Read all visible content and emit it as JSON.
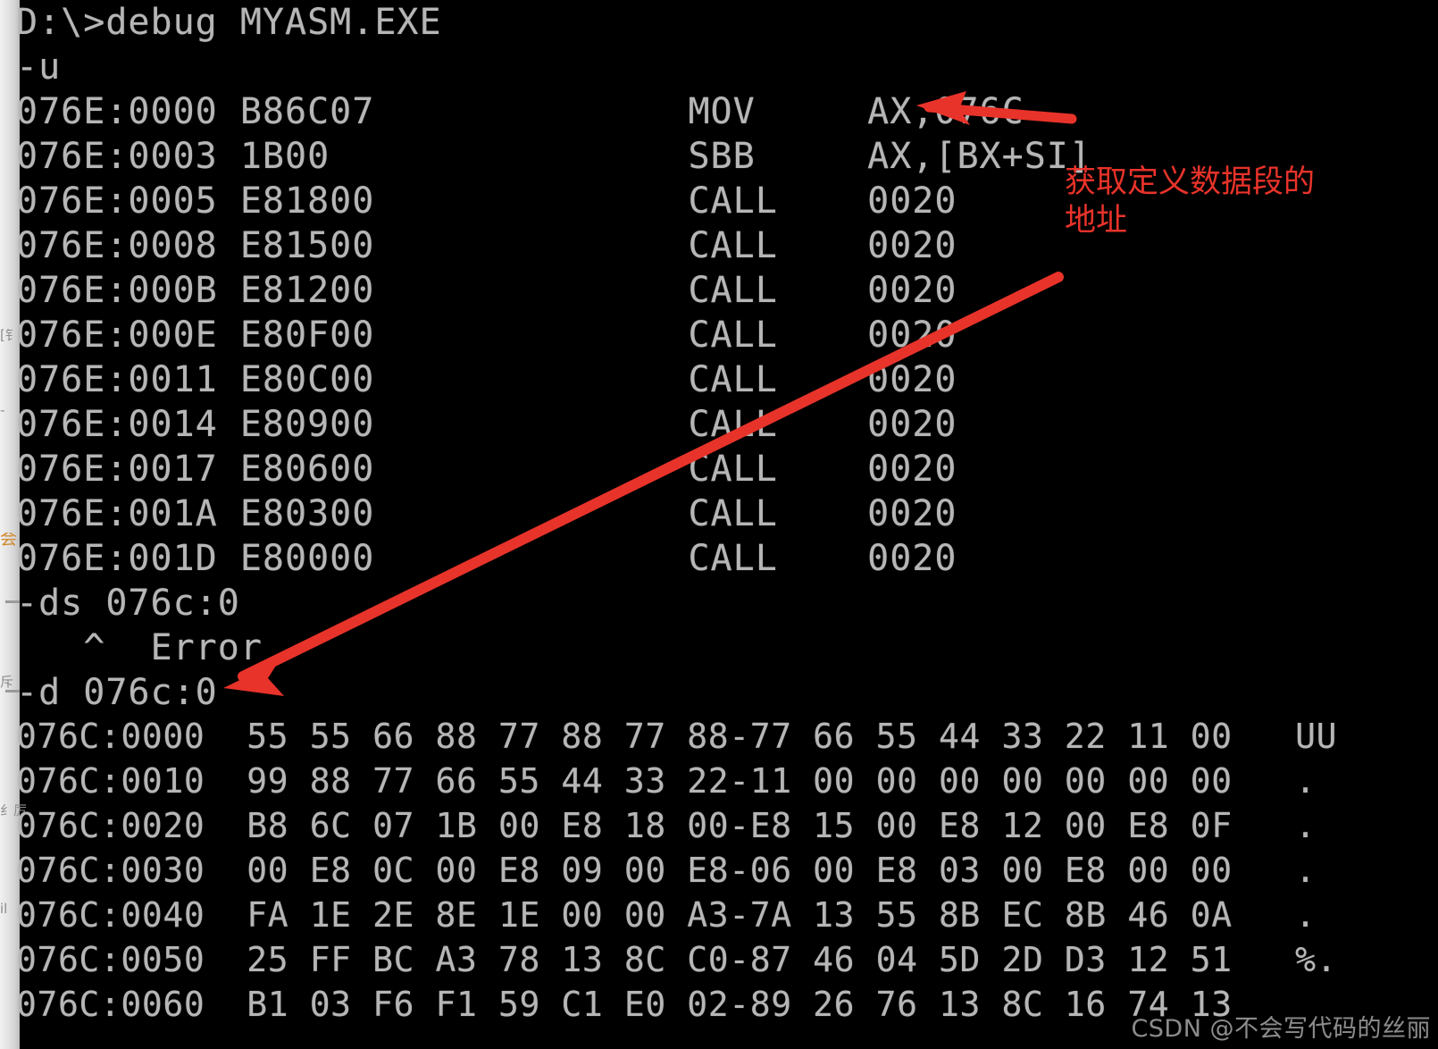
{
  "terminal": {
    "prompt_line": "D:\\>debug MYASM.EXE",
    "unassemble_command": "-u",
    "disassembly": [
      "076E:0000 B86C07              MOV     AX,076C",
      "076E:0003 1B00                SBB     AX,[BX+SI]",
      "076E:0005 E81800              CALL    0020",
      "076E:0008 E81500              CALL    0020",
      "076E:000B E81200              CALL    0020",
      "076E:000E E80F00              CALL    0020",
      "076E:0011 E80C00              CALL    0020",
      "076E:0014 E80900              CALL    0020",
      "076E:0017 E80600              CALL    0020",
      "076E:001A E80300              CALL    0020",
      "076E:001D E80000              CALL    0020"
    ],
    "bad_command": "-ds 076c:0",
    "error_caret": "   ^  Error",
    "dump_command": "-d 076c:0",
    "dump": [
      "076C:0000  55 55 66 88 77 88 77 88-77 66 55 44 33 22 11 00   UU",
      "076C:0010  99 88 77 66 55 44 33 22-11 00 00 00 00 00 00 00   .",
      "076C:0020  B8 6C 07 1B 00 E8 18 00-E8 15 00 E8 12 00 E8 0F   .",
      "076C:0030  00 E8 0C 00 E8 09 00 E8-06 00 E8 03 00 E8 00 00   .",
      "076C:0040  FA 1E 2E 8E 1E 00 00 A3-7A 13 55 8B EC 8B 46 0A   .",
      "076C:0050  25 FF BC A3 78 13 8C C0-87 46 04 5D 2D D3 12 51   %.",
      "076C:0060  B1 03 F6 F1 59 C1 E0 02-89 26 76 13 8C 16 74 13"
    ]
  },
  "annotations": {
    "arrow_color": "#e8332a",
    "note_text": "获取定义数据段的\n地址",
    "mov_arrow_label": "arrow-to-mov-ax-076c",
    "dump_arrow_label": "arrow-to-dump-command"
  },
  "background_fragments": {
    "frag_1": "[钅",
    "frag_2": "-",
    "frag_3": "会",
    "frag_4": "斥",
    "frag_5": "纟厉",
    "frag_6": "il"
  },
  "watermark": {
    "text": "CSDN @不会写代码的丝丽"
  }
}
